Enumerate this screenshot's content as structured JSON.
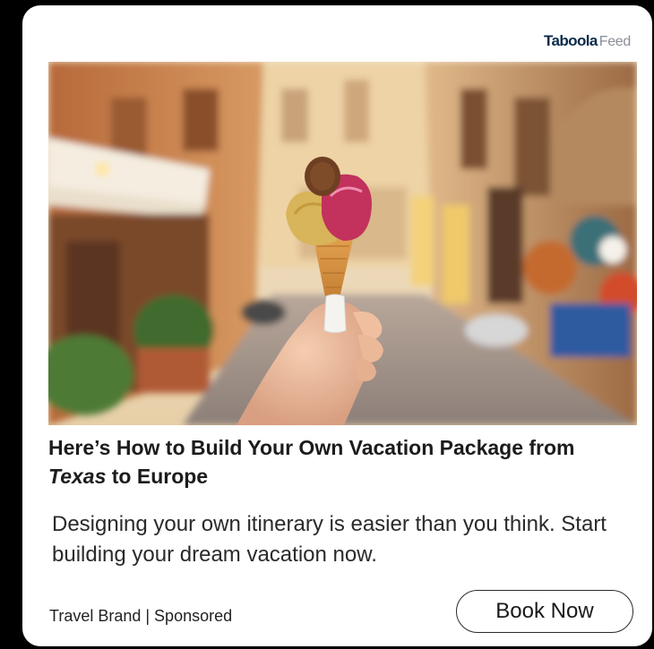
{
  "provider": {
    "name": "Taboola",
    "suffix": "Feed"
  },
  "ad": {
    "image_alt": "Hand holding an ice cream cone on a European street",
    "headline": {
      "part1": "Here’s How to Build Your Own Vacation Package from ",
      "emphasis": "Texas",
      "part2": " to Europe"
    },
    "description": "Designing your own itinerary is easier than you think. Start building your dream vacation now.",
    "brand_line": "Travel Brand | Sponsored",
    "cta_label": "Book Now"
  },
  "colors": {
    "background": "#000000",
    "card": "#ffffff",
    "brand_navy": "#0b2a4a",
    "text": "#1c1c1c"
  }
}
